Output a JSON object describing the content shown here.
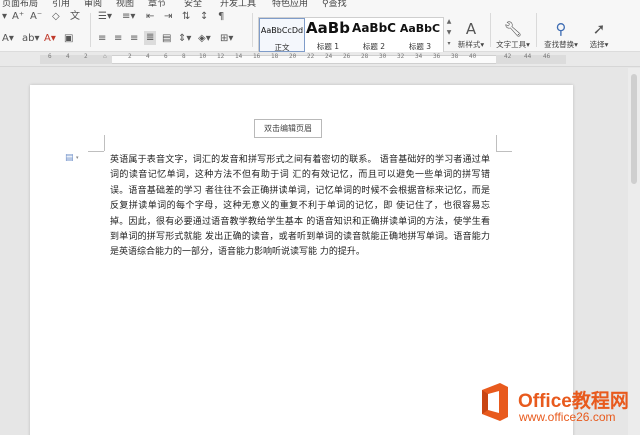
{
  "menu": {
    "items": [
      "页面布局",
      "引用",
      "审阅",
      "视图",
      "章节",
      "安全",
      "开发工具",
      "特色应用",
      "查找"
    ]
  },
  "ribbon": {
    "styles": [
      {
        "sample": "AaBbCcDd",
        "label": "正文"
      },
      {
        "sample": "AaBb",
        "label": "标题 1"
      },
      {
        "sample": "AaBbC",
        "label": "标题 2"
      },
      {
        "sample": "AaBbC",
        "label": "标题 3"
      }
    ],
    "new_style_label": "新样式",
    "text_tools_label": "文字工具",
    "find_replace_label": "查找替换",
    "select_label": "选择"
  },
  "ruler": {
    "numbers": [
      "6",
      "4",
      "2",
      "2",
      "4",
      "6",
      "8",
      "10",
      "12",
      "14",
      "16",
      "18",
      "20",
      "22",
      "24",
      "26",
      "28",
      "30",
      "32",
      "34",
      "36",
      "38",
      "40",
      "42",
      "44",
      "46"
    ]
  },
  "document": {
    "header_button": "双击编辑页眉",
    "paragraph": "英语属于表音文字，词汇的发音和拼写形式之间有着密切的联系。 语音基础好的学习者通过单词的读音记忆单词，这种方法不但有助于词 汇的有效记忆，而且可以避免一些单词的拼写错误。语音基础差的学习 者往往不会正确拼读单词，记忆单词的时候不会根据音标来记忆，而是 反复拼读单词的每个字母，这种无意义的重复不利于单词的记忆，即 使记住了，也很容易忘掉。因此，很有必要通过语音教学教给学生基本 的语音知识和正确拼读单词的方法，使学生看到单词的拼写形式就能 发出正确的读音，或者听到单词的读音就能正确地拼写单词。语音能力是英语综合能力的一部分，语音能力影响听说读写能 力的提升。"
  },
  "watermark": {
    "title": "Office教程网",
    "url": "www.office26.com"
  },
  "colors": {
    "brand_orange": "#e85a1d",
    "selection_border": "#7f9cc9"
  }
}
